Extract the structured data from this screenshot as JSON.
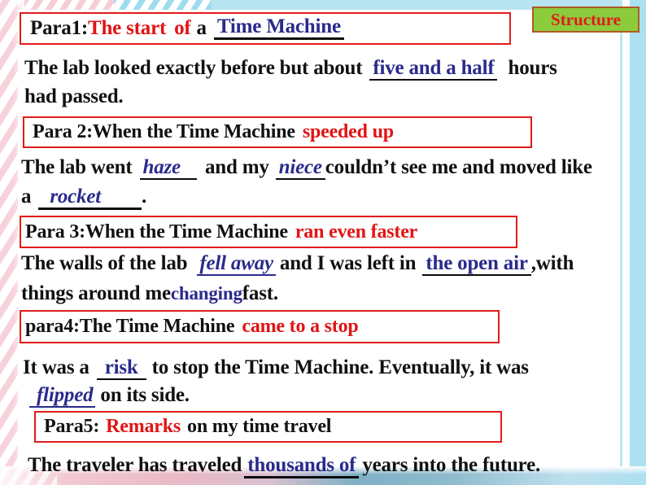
{
  "slide": {
    "badge": {
      "label": "Structure"
    },
    "colors": {
      "box_border": "#e01b1b",
      "highlight_red": "#e11414",
      "answer_blue": "#2a2a8c",
      "badge_bg": "#8ccc3c",
      "badge_border": "#b05a22",
      "badge_text": "#e01b1b",
      "frame_pink": "#f6cdd6",
      "frame_blue": "#ace0f0"
    },
    "paragraphs": [
      {
        "heading": {
          "prefix": "Para1:",
          "highlight": "The start",
          "mid": "of",
          "tail": "a",
          "answer": "Time Machine"
        },
        "body": {
          "pre": "The lab looked exactly before but about",
          "answer": "five and a half",
          "post": "hours",
          "post2": "had passed."
        }
      },
      {
        "heading": {
          "prefix": "Para 2:When the Time Machine",
          "highlight": "speeded up"
        },
        "body": {
          "pre": "The lab went",
          "answer1": "haze",
          "mid": "and my",
          "answer2": "niece",
          "post": "couldn’t see me and moved like",
          "line2_pre": "a",
          "answer3": "rocket",
          "line2_post": "."
        }
      },
      {
        "heading": {
          "prefix": "Para 3:When the Time Machine",
          "highlight": "ran even faster"
        },
        "body": {
          "pre": "The walls of the lab",
          "answer1": "fell away",
          "mid": "and I was left in",
          "answer2": "the open air",
          "post": ",with",
          "line2_pre": "things around me",
          "answer3": "changing",
          "line2_post": "fast."
        }
      },
      {
        "heading": {
          "prefix": "para4:The Time Machine",
          "highlight": "came to a stop"
        },
        "body": {
          "pre": "It was a",
          "answer1": "risk",
          "post": "to stop the Time Machine. Eventually, it was",
          "answer2": "flipped",
          "line2_post": "on its side."
        }
      },
      {
        "heading": {
          "prefix": "Para5:",
          "highlight": "Remarks",
          "tail": "on my time travel"
        },
        "body": {
          "pre": "The traveler has traveled",
          "answer": "thousands of",
          "post": "years into the future."
        }
      }
    ]
  }
}
